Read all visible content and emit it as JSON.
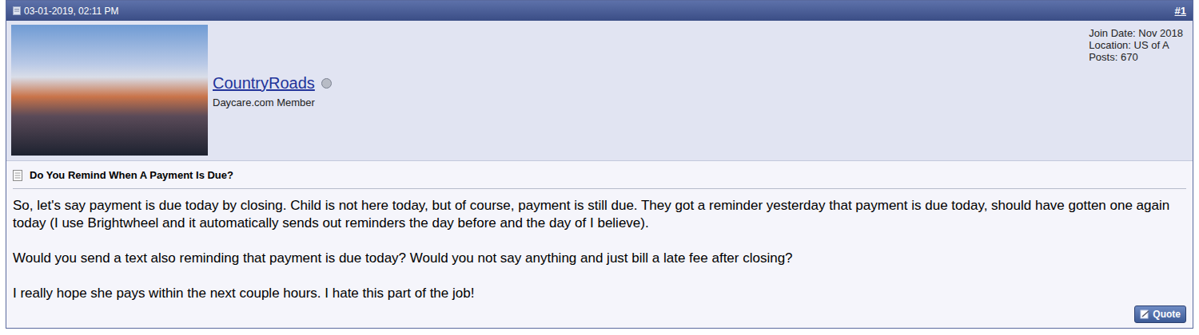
{
  "post": {
    "date": "03-01-2019, 02:11 PM",
    "number": "#1"
  },
  "user": {
    "name": "CountryRoads",
    "online": false,
    "title": "Daycare.com Member",
    "stats": [
      "Join Date: Nov 2018",
      "Location: US of A",
      "Posts: 670"
    ]
  },
  "message": {
    "title": "Do You Remind When A Payment Is Due?",
    "paragraphs": [
      "So, let's say payment is due today by closing. Child is not here today, but of course, payment is still due. They got a reminder yesterday that payment is due today, should have gotten one again today (I use Brightwheel and it automatically sends out reminders the day before and the day of I believe).",
      "Would you send a text also reminding that payment is due today? Would you not say anything and just bill a late fee after closing?",
      "I really hope she pays within the next couple hours. I hate this part of the job!"
    ]
  },
  "buttons": [
    "Quote"
  ]
}
